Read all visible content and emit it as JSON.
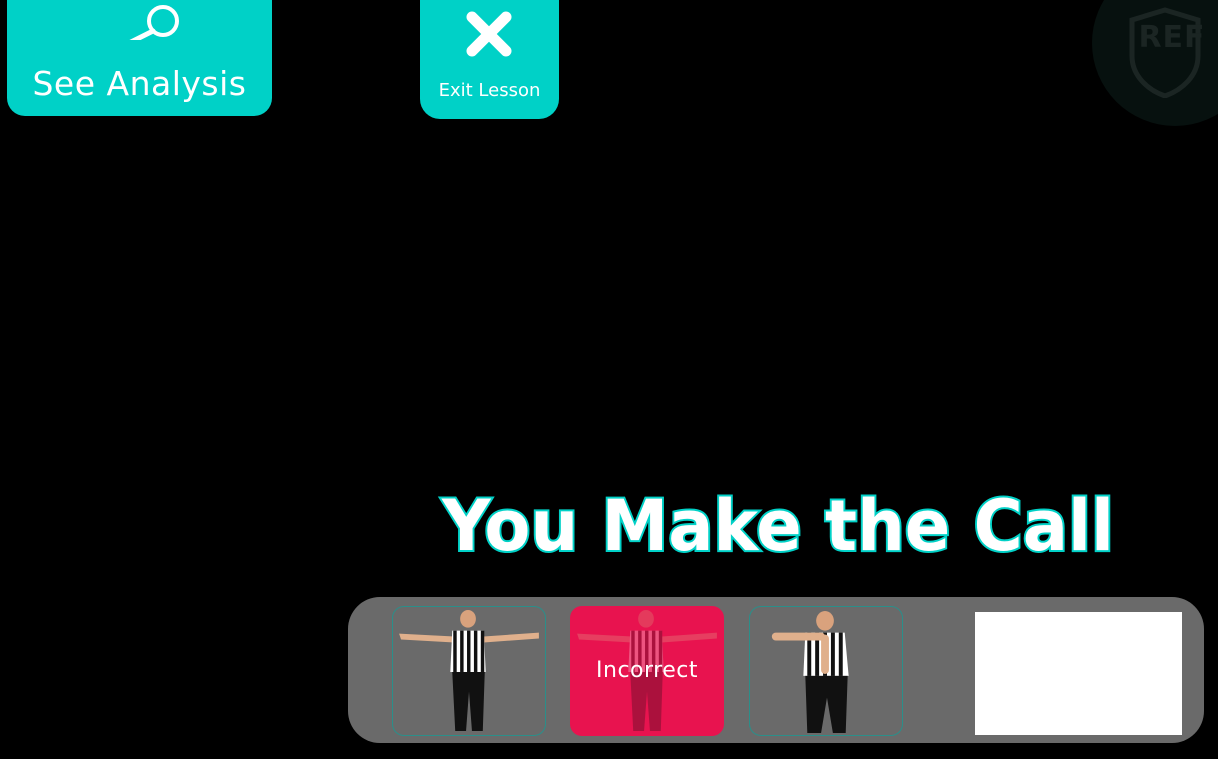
{
  "buttons": {
    "analysis": {
      "label": "See Analysis",
      "icon": "magnifier-icon"
    },
    "exit": {
      "label": "Exit Lesson",
      "icon": "close-icon"
    }
  },
  "logo": {
    "text": "REF"
  },
  "heading": {
    "text": "You Make the Call"
  },
  "choices": [
    {
      "gesture": "arms-extended-sideways",
      "state": "default"
    },
    {
      "gesture": "arms-extended-sideways",
      "state": "incorrect",
      "status_label": "Incorrect"
    },
    {
      "gesture": "timeout-t-signal",
      "state": "default"
    }
  ],
  "colors": {
    "accent": "#00d1c7",
    "incorrect": "#e8134f",
    "tray": "#6a6a6a",
    "background": "#000000"
  }
}
